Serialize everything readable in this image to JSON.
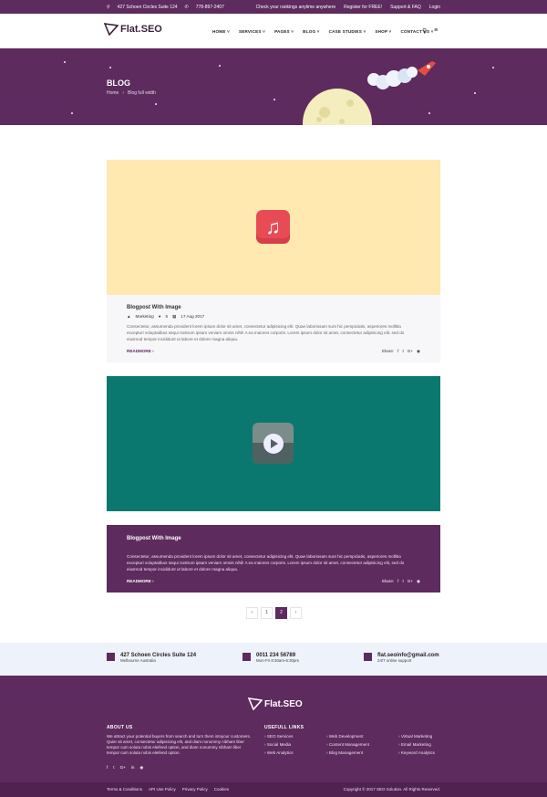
{
  "topbar": {
    "address": "427 Schoen Circles Suite 124",
    "phone": "778-897-2407",
    "rankings": "Check your rankings anytime anywhere",
    "register": "Register for FREE!",
    "support": "Support & FAQ",
    "login": "Login"
  },
  "nav": {
    "logo": "Flat.SEO",
    "items": [
      "HOME",
      "SERVICES",
      "PAGES",
      "BLOG",
      "CASE STUDIES",
      "SHOP",
      "CONTACT US"
    ]
  },
  "hero": {
    "title": "BLOG",
    "crumbs": [
      "Home",
      "Blog full width"
    ]
  },
  "posts": [
    {
      "title": "Blogpost With Image",
      "category": "Marketing",
      "comments": "5",
      "date": "17 Aug 2017",
      "excerpt": "Consectetur, assumenda provident lorem ipsum dolor sit amet, consectetur adipisicing elit. Quae laboriosam sunt hic perspiciatis, asperiores mollitia excepturi voluptatibus sequi nostrum ipsam veniam omnis nihil! A ea maiores corporis. Lorem ipsum dolor sit amet, consectetur adipisicing elit, sed do eiusmod tempor incididunt ut labore et dolore magna aliqua.",
      "readmore": "READMORE",
      "share": "Share:"
    },
    {
      "title": "Blogpost With Image",
      "excerpt": "Consectetur, assumenda provident lorem ipsum dolor sit amet, consectetur adipisicing elit. Quae laboriosam sunt hic perspiciatis, asperiores mollitia excepturi voluptatibus sequi nostrum ipsam veniam omnis nihil! A ea maiores corporis. Lorem ipsum dolor sit amet, consectetur adipisicing elit, sed do eiusmod tempor incididunt ut labore et dolore magna aliqua.",
      "readmore": "READMORE",
      "share": "Share:"
    }
  ],
  "pagination": {
    "prev": "‹",
    "p1": "1",
    "p2": "2",
    "next": "›"
  },
  "contact": {
    "addr": "427 Schoen Circles Suite 124",
    "addr_sub": "Melbourne Australia",
    "phone": "0011 234 56789",
    "phone_sub": "Mon-Fri 8:30am-6:30pm",
    "email": "flat.seoinfo@gmail.com",
    "email_sub": "24/7 online support"
  },
  "footer": {
    "about_h": "ABOUT US",
    "about": "We attract your potential buyers from search and turn them intoyour customers. Quier sit amet, consectetur adipisicing elit, and diam nonummy nibham liber tempor cum soluta nobis eleifend option, and diam nonummy nibham liber tempor cum soluta nobis eleifend option.",
    "links_h": "USEFULL LINKS",
    "col1": [
      "SEO Services",
      "Social Media",
      "Web Analytics"
    ],
    "col2": [
      "Web Development",
      "Content Management",
      "Blog Management"
    ],
    "col3": [
      "Virtual Marketing",
      "Email Marketing",
      "Keyword Analytics"
    ],
    "bottom_links": [
      "Terms & Conditions",
      "API Use Policy",
      "Privacy Policy",
      "Cookies"
    ],
    "copyright": "Copyright © 2017 SEO Solution. All Rights Reserved."
  },
  "colors": {
    "brand": "#5d2b5e",
    "card1_media": "#ffe9b0",
    "card2_media": "#0b7870"
  }
}
